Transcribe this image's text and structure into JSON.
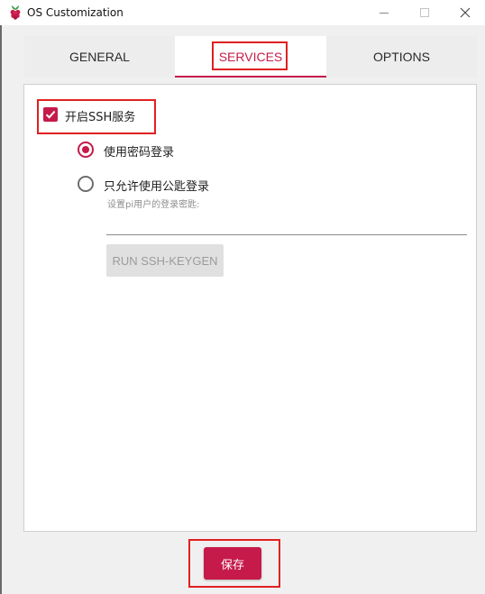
{
  "window": {
    "title": "OS Customization",
    "icon": "raspberry-icon"
  },
  "tabs": [
    {
      "label": "GENERAL",
      "active": false
    },
    {
      "label": "SERVICES",
      "active": true
    },
    {
      "label": "OPTIONS",
      "active": false
    }
  ],
  "services": {
    "ssh_enable_label": "开启SSH服务",
    "ssh_enabled": true,
    "auth_options": [
      {
        "label": "使用密码登录",
        "selected": true
      },
      {
        "label": "只允许使用公匙登录",
        "selected": false
      }
    ],
    "pubkey_hint": "设置pi用户的登录密匙:",
    "pubkey_value": "",
    "keygen_label": "RUN SSH-KEYGEN"
  },
  "footer": {
    "save_label": "保存"
  },
  "colors": {
    "accent": "#c51a4a",
    "highlight_box": "#e02020"
  }
}
